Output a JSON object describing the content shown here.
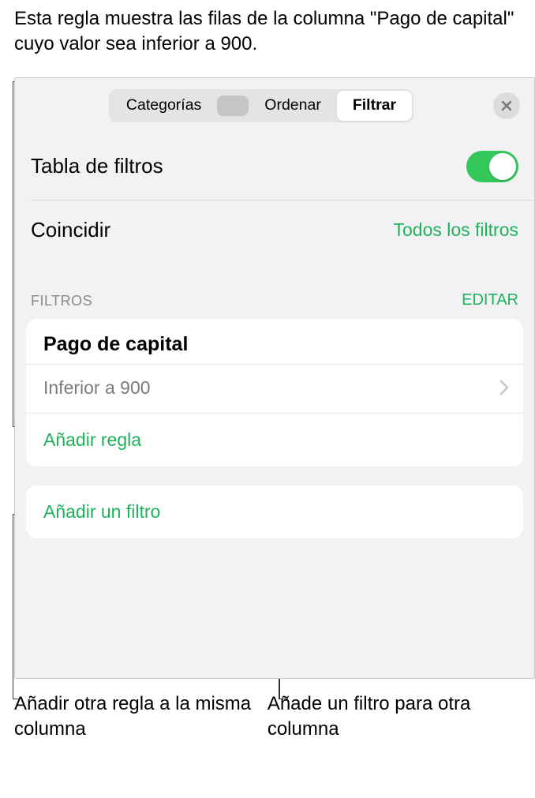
{
  "annotations": {
    "top": "Esta regla muestra las filas de la columna \"Pago de capital\" cuyo valor sea inferior a 900.",
    "bottom_left": "Añadir otra regla a la misma columna",
    "bottom_right": "Añade un filtro para otra columna"
  },
  "segmented": {
    "categorias": "Categorías",
    "ordenar": "Ordenar",
    "filtrar": "Filtrar"
  },
  "filters_table": {
    "label": "Tabla de filtros"
  },
  "match": {
    "label": "Coincidir",
    "value": "Todos los filtros"
  },
  "list": {
    "header": "FILTROS",
    "edit": "EDITAR",
    "column_name": "Pago de capital",
    "rule_text": "Inferior a 900",
    "add_rule": "Añadir regla",
    "add_filter": "Añadir un filtro"
  },
  "icons": {
    "close": "close-icon",
    "chevron_right": "chevron-right-icon"
  },
  "colors": {
    "accent": "#1eb25a",
    "toggle_on": "#34c759",
    "panel_bg": "#f2f2f4"
  }
}
